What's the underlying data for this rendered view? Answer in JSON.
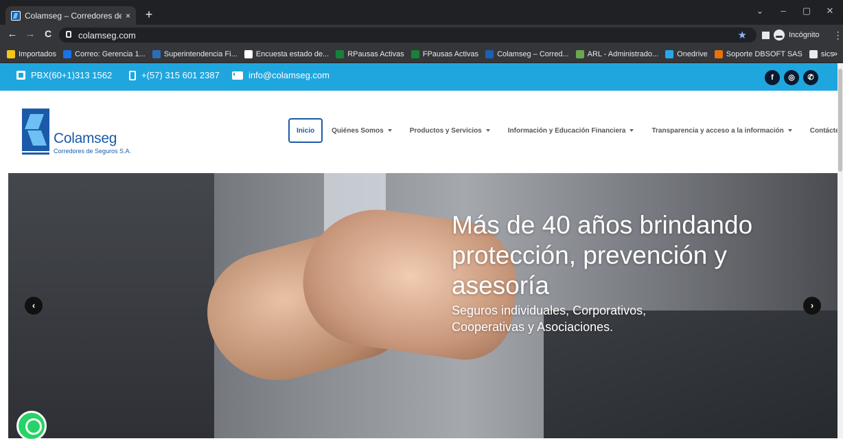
{
  "browser": {
    "tab_title": "Colamseg – Corredores de segur",
    "tab_close": "×",
    "new_tab": "+",
    "url": "colamseg.com",
    "profile_label": "Incógnito",
    "back": "←",
    "forward": "→",
    "reload": "C",
    "star": "★",
    "menu": "⋮",
    "bookmarks_more": "»",
    "window_controls": [
      "⌄",
      "–",
      "▢",
      "✕"
    ],
    "bookmarks": [
      {
        "label": "Importados",
        "icon": "folder-icon",
        "color": "#f5c518"
      },
      {
        "label": "Correo: Gerencia 1...",
        "icon": "outlook-icon",
        "color": "#1a73e8"
      },
      {
        "label": "Superintendencia Fi...",
        "icon": "sfc-icon",
        "color": "#2d6db5"
      },
      {
        "label": "Encuesta estado de...",
        "icon": "google-icon",
        "color": "#ffffff"
      },
      {
        "label": "RPausas Activas",
        "icon": "forms-icon",
        "color": "#188038"
      },
      {
        "label": "FPausas Activas",
        "icon": "forms-icon",
        "color": "#188038"
      },
      {
        "label": "Colamseg – Corred...",
        "icon": "colamseg-icon",
        "color": "#1d5fb3"
      },
      {
        "label": "ARL - Administrado...",
        "icon": "arl-icon",
        "color": "#6aa84f"
      },
      {
        "label": "Onedrive",
        "icon": "onedrive-icon",
        "color": "#28a8ea"
      },
      {
        "label": "Soporte DBSOFT SAS",
        "icon": "dbsoft-icon",
        "color": "#e8710a"
      },
      {
        "label": "sics",
        "icon": "document-icon",
        "color": "#e8eaed"
      }
    ]
  },
  "topbar": {
    "color": "#1fa6df",
    "phone": "PBX(60+1)313 1562",
    "mobile": "+(57) 315 601 2387",
    "email": "info@colamseg.com",
    "social": [
      {
        "icon": "facebook-icon",
        "glyph": "f"
      },
      {
        "icon": "instagram-icon",
        "glyph": "◎"
      },
      {
        "icon": "whatsapp-icon",
        "glyph": "✆"
      }
    ]
  },
  "logo": {
    "name": "Colamseg",
    "subtitle": "Corredores de Seguros S.A."
  },
  "nav": [
    {
      "label": "Inicio",
      "dropdown": false,
      "active": true
    },
    {
      "label": "Quiénes Somos",
      "dropdown": true
    },
    {
      "label": "Productos y Servicios",
      "dropdown": true
    },
    {
      "label": "Información y Educación Financiera",
      "dropdown": true
    },
    {
      "label": "Transparencia y acceso a la información",
      "dropdown": true
    },
    {
      "label": "Contáctenos",
      "dropdown": false
    }
  ],
  "hero": {
    "title": "Más de 40 años brindando protección, prevención y asesoría",
    "subtitle": "Seguros individuales, Corporativos, Cooperativas y Asociaciones.",
    "prev": "‹",
    "next": "›"
  }
}
